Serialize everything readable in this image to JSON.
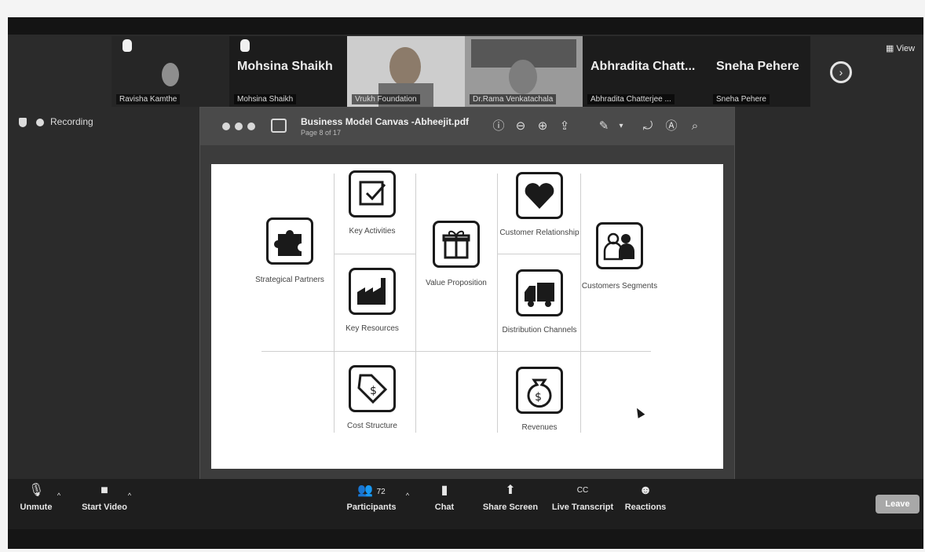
{
  "gallery": {
    "tiles": [
      {
        "big_name": "",
        "label": "Ravisha Kamthe"
      },
      {
        "big_name": "Mohsina Shaikh",
        "label": "Mohsina Shaikh"
      },
      {
        "big_name": "",
        "label": "Vrukh Foundation"
      },
      {
        "big_name": "",
        "label": "Dr.Rama Venkatachala"
      },
      {
        "big_name": "Abhradita Chatt...",
        "label": "Abhradita Chatterjee ..."
      },
      {
        "big_name": "Sneha Pehere",
        "label": "Sneha Pehere"
      }
    ],
    "view_label": "View"
  },
  "recording": {
    "label": "Recording"
  },
  "pdf": {
    "title": "Business Model Canvas -Abheejit.pdf",
    "page": "Page 8 of 17",
    "blocks": {
      "key_partners": "Strategical Partners",
      "key_activities": "Key Activities",
      "key_resources": "Key Resources",
      "value_proposition": "Value Proposition",
      "customer_relationship": "Customer Relationship",
      "channels": "Distribution Channels",
      "customer_segments": "Customers Segments",
      "cost_structure": "Cost Structure",
      "revenues": "Revenues"
    }
  },
  "controls": {
    "unmute": "Unmute",
    "start_video": "Start Video",
    "participants": "Participants",
    "participants_count": "72",
    "chat": "Chat",
    "share_screen": "Share Screen",
    "live_transcript": "Live Transcript",
    "reactions": "Reactions",
    "leave": "Leave"
  }
}
